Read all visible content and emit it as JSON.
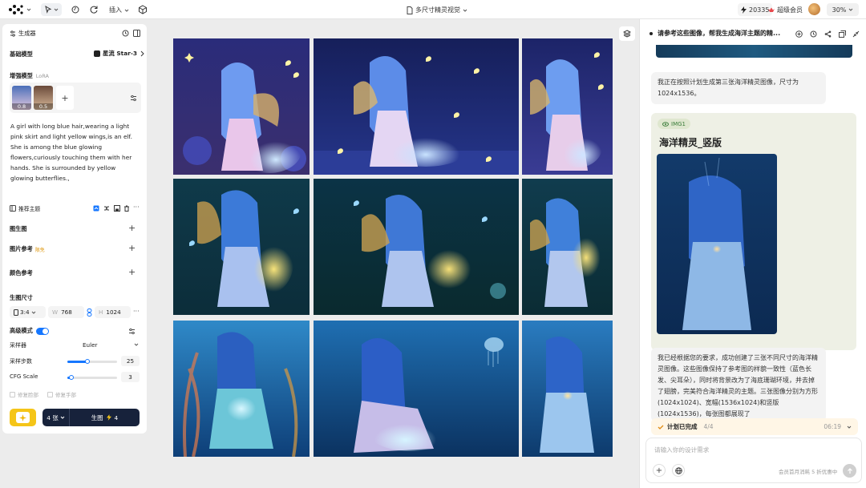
{
  "topbar": {
    "insert_label": "插入",
    "doc_title": "多尺寸精灵视觉",
    "credits": "20335",
    "vip_label": "超级会员",
    "zoom": "30%"
  },
  "left": {
    "header_title": "生成器",
    "base_model_label": "基础模型",
    "base_model_value": "星流 Star-3",
    "enhance_label": "增强模型",
    "enhance_sub": "LoRA",
    "lora": [
      {
        "weight": "0.8"
      },
      {
        "weight": "0.5"
      }
    ],
    "prompt": "A girl with long blue hair,wearing a light pink skirt and light yellow wings,is an elf. She is among the blue glowing flowers,curiously touching them with her hands. She is surrounded by yellow glowing butterflies.,",
    "recommend_label": "推荐主题",
    "img2img_label": "图生图",
    "img_ref_label": "图片参考",
    "img_ref_badge": "限免",
    "color_ref_label": "颜色参考",
    "size_label": "生图尺寸",
    "ratio": "3:4",
    "w_label": "W",
    "width": "768",
    "h_label": "H",
    "height": "1024",
    "advanced_label": "高级模式",
    "sampler_label": "采样器",
    "sampler_value": "Euler",
    "steps_label": "采样步数",
    "steps_value": "25",
    "steps_fraction": 0.4,
    "cfg_label": "CFG Scale",
    "cfg_value": "3",
    "cfg_fraction": 0.08,
    "fix_face_label": "修复脸部",
    "fix_hand_label": "修复手部",
    "count_label": "4 张",
    "generate_label": "生图",
    "generate_cost": "4"
  },
  "right": {
    "title": "请参考这些图像，帮我生成海洋主题的精...",
    "msg1": "我正在按照计划生成第三张海洋精灵图像，尺寸为1024x1536。",
    "img_tag": "IMG1",
    "card_title": "海洋精灵_竖版",
    "msg2": "我已经根据您的要求，成功创建了三张不同尺寸的海洋精灵图像。这些图像保持了参考图的样貌一致性（蓝色长发、尖耳朵），同时将背景改为了海底珊瑚环境，并去掉了翅膀，完美符合海洋精灵的主题。三张图像分别为方形(1024x1024)、宽幅(1536x1024)和竖版(1024x1536)，每张图都展现了",
    "plan_label": "计划已完成",
    "plan_progress": "4/4",
    "plan_time": "06:19",
    "input_placeholder": "请输入你的设计需求",
    "promo": "会员首月消耗 5 折优惠中"
  },
  "colors": {
    "accent": "#1677ff",
    "generate_bg": "#17223b",
    "sparkle_btn": "#f5c518"
  }
}
